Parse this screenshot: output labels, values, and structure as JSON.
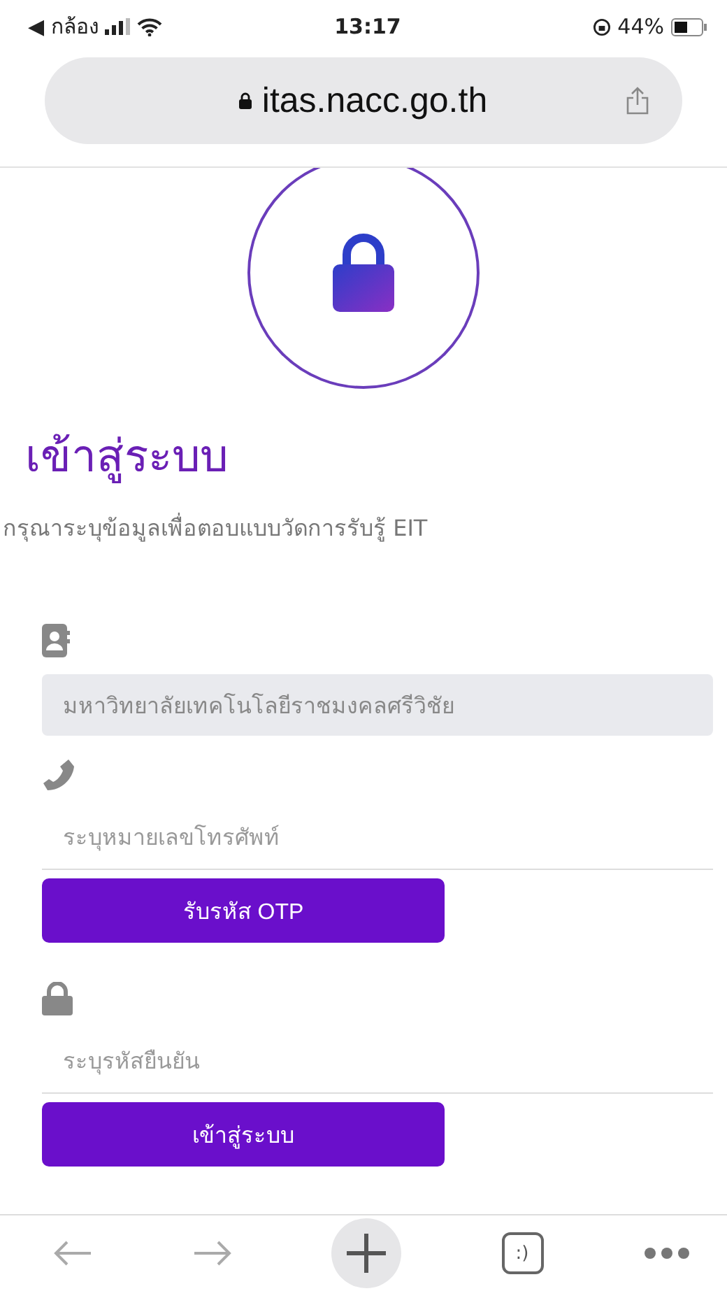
{
  "status_bar": {
    "back_label": "◀ กล้อง",
    "time": "13:17",
    "battery": "44%"
  },
  "address_bar": {
    "url": "itas.nacc.go.th"
  },
  "login": {
    "title": "เข้าสู่ระบบ",
    "subtitle": "กรุณาระบุข้อมูลเพื่อตอบแบบวัดการรับรู้ EIT"
  },
  "form": [
    {
      "kind": "contact",
      "value": "มหาวิทยาลัยเทคโนโลยีราชมงคลศรีวิชัย",
      "disabled": true
    },
    {
      "kind": "phone",
      "placeholder": "ระบุหมายเลขโทรศัพท์",
      "disabled": false
    },
    {
      "kind": "button",
      "label": "รับรหัส OTP"
    },
    {
      "kind": "code",
      "placeholder": "ระบุรหัสยืนยัน",
      "disabled": false
    },
    {
      "kind": "button",
      "label": "เข้าสู่ระบบ"
    }
  ],
  "toolbar": {
    "tabs_label": ":)"
  }
}
